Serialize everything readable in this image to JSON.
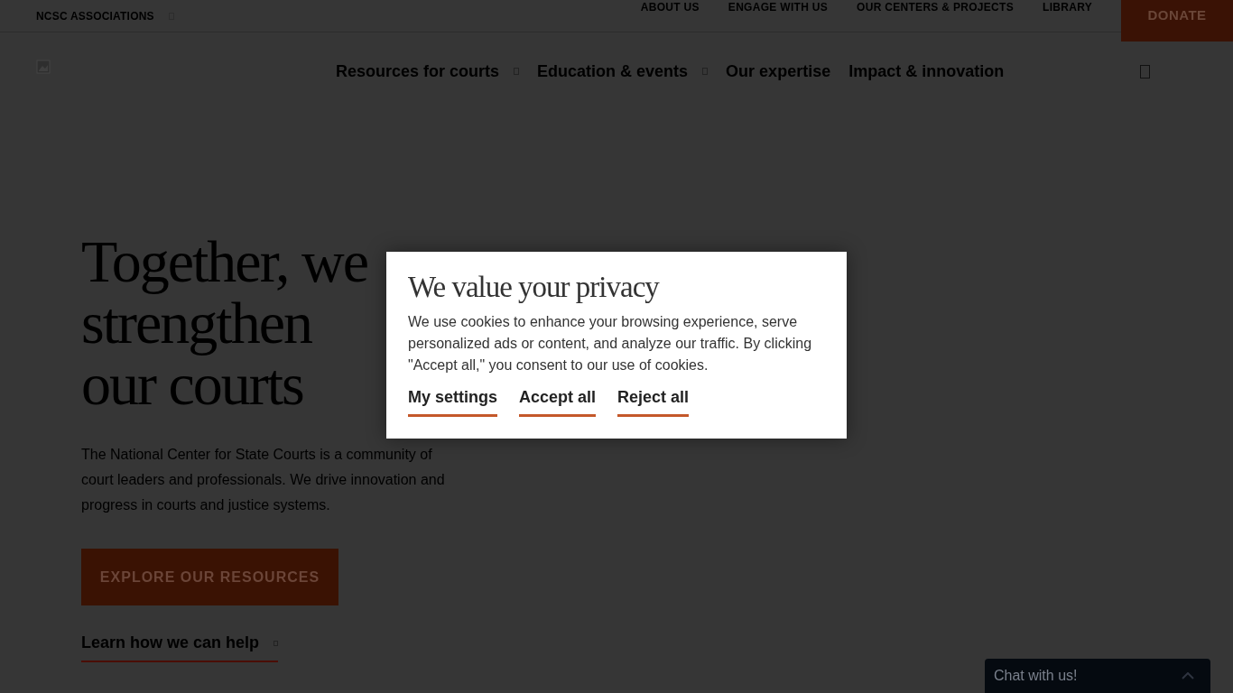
{
  "top_bar": {
    "associations": {
      "label": "NCSC ASSOCIATIONS",
      "has_dropdown": true
    },
    "links": [
      {
        "label": "ABOUT US"
      },
      {
        "label": "ENGAGE WITH US"
      },
      {
        "label": "OUR CENTERS & PROJECTS"
      },
      {
        "label": "LIBRARY"
      }
    ],
    "donate": "DONATE"
  },
  "main_nav": [
    {
      "label": "Resources for courts",
      "has_dropdown": true
    },
    {
      "label": "Education & events",
      "has_dropdown": true
    },
    {
      "label": "Our expertise",
      "has_dropdown": false
    },
    {
      "label": "Impact & innovation",
      "has_dropdown": false
    }
  ],
  "hero": {
    "headline": [
      "Together, we",
      "strengthen",
      "our courts"
    ],
    "text": "The National Center for State Courts is a community of court leaders and professionals. We drive innovation and progress in courts and justice systems.",
    "button": "EXPLORE OUR RESOURCES",
    "link": "Learn how we can help"
  },
  "cookie_dialog": {
    "title": "We value your privacy",
    "text": "We use cookies to enhance your browsing experience, serve personalized ads or content, and analyze our traffic. By clicking \"Accept all,\" you consent to our use of cookies.",
    "buttons": [
      "My settings",
      "Accept all",
      "Reject all"
    ]
  },
  "chat": {
    "label": "Chat with us!",
    "expanded": false
  }
}
